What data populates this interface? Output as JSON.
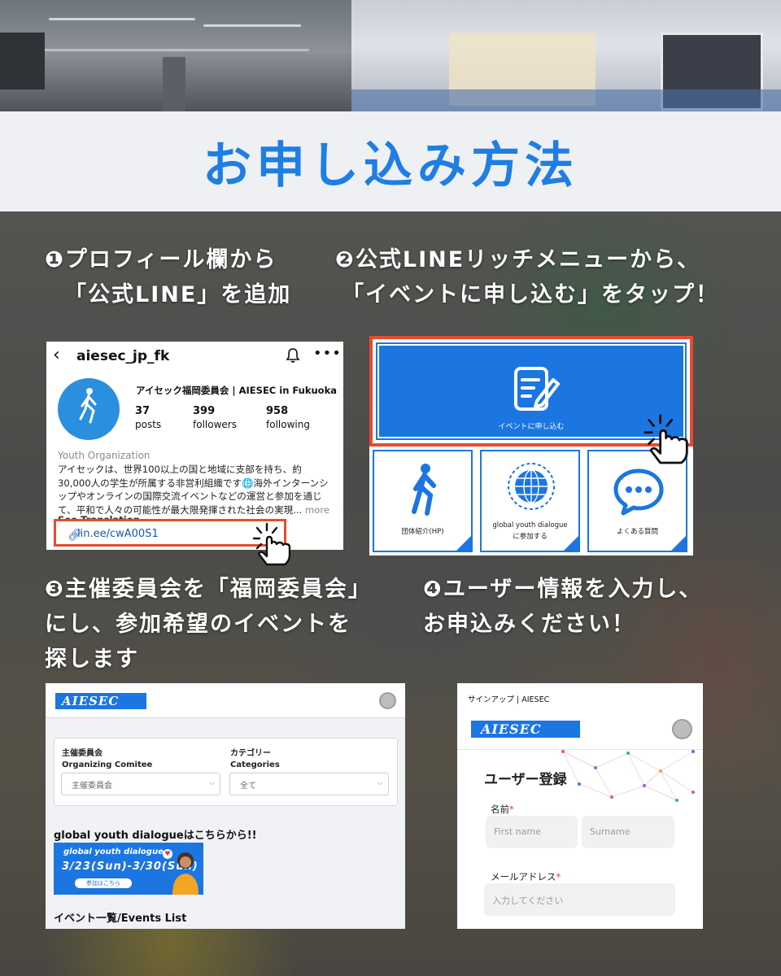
{
  "title": "お申し込み方法",
  "steps": {
    "step1": [
      "❶プロフィール欄から",
      "「公式LINE」を追加"
    ],
    "step2": [
      "❷公式LINEリッチメニューから、",
      "「イベントに申し込む」をタップ！"
    ],
    "step3": [
      "❸主催委員会を「福岡委員会」",
      "にし、参加希望のイベントを",
      "探します"
    ],
    "step4": [
      "❹ユーザー情報を入力し、",
      "お申込みください！"
    ]
  },
  "instagram": {
    "handle": "aiesec_jp_fk",
    "name": "アイセック福岡委員会 | AIESEC in Fukuoka",
    "posts_count": "37",
    "posts_label": "posts",
    "followers_count": "399",
    "followers_label": "followers",
    "following_count": "958",
    "following_label": "following",
    "category": "Youth Organization",
    "bio": "アイセックは、世界100以上の国と地域に支部を持ち、約30,000人の学生が所属する非営利組織です🌐海外インターンシップやオンラインの国際交流イベントなどの運営と参加を通じて、平和で人々の可能性が最大限発揮された社会の実現...",
    "more": "more",
    "see_translation": "See Translation",
    "link": "lin.ee/cwA00S1"
  },
  "line_menu": {
    "apply_label": "イベントに申し込む",
    "tiles": [
      {
        "icon": "walking-person-icon",
        "label": "団体紹介(HP)"
      },
      {
        "icon": "globe-icon",
        "label": "global youth dialogueに参加する"
      },
      {
        "icon": "chat-bubble-icon",
        "label": "よくある質問"
      }
    ],
    "accent": "#1b76e2",
    "highlight": "#e64b2f"
  },
  "event_page": {
    "logo": "AIESEC",
    "organizer_label_ja": "主催委員会",
    "organizer_label_en": "Organizing Comitee",
    "organizer_value": "主催委員会",
    "category_label_ja": "カテゴリー",
    "category_label_en": "Categories",
    "category_value": "全て",
    "gyd_heading": "global youth dialogueはこちらから!!",
    "banner_title": "global youth dialogue",
    "banner_dates": "3/23(Sun)-3/30(Sun)",
    "banner_button": "参加はこちら",
    "events_list": "イベント一覧/Events List"
  },
  "signup_page": {
    "breadcrumb": "サインアップ | AIESEC",
    "logo": "AIESEC",
    "heading": "ユーザー登録",
    "name_label": "名前",
    "first_name_placeholder": "First name",
    "surname_placeholder": "Surname",
    "email_label": "メールアドレス",
    "email_placeholder": "入力してください"
  }
}
